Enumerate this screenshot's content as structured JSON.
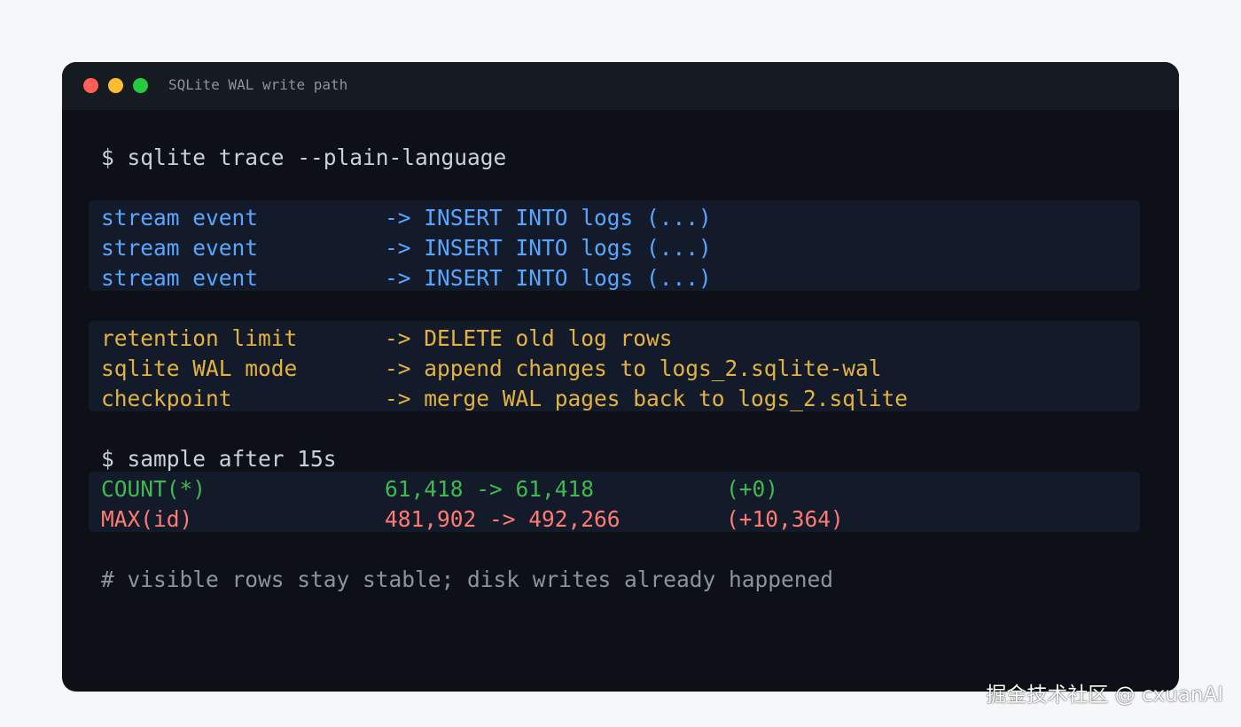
{
  "window": {
    "title": "SQLite WAL write path",
    "controls": [
      {
        "name": "close",
        "color": "#ff5f57"
      },
      {
        "name": "minimize",
        "color": "#febc2e"
      },
      {
        "name": "zoom",
        "color": "#28c840"
      }
    ]
  },
  "colors": {
    "background": "#f6f7f9",
    "terminal_bg": "#0d1117",
    "titlebar_bg": "#161b22",
    "block_bg": "#131a2a",
    "prompt": "#c9d1d9",
    "blue": "#58a6ff",
    "orange": "#e3b341",
    "green": "#3fb950",
    "red": "#ff7b72",
    "comment": "#8b949e"
  },
  "terminal": {
    "command_1": "$ sqlite trace --plain-language",
    "insert_rows": [
      {
        "label": "stream event",
        "action": "-> INSERT INTO logs (...)"
      },
      {
        "label": "stream event",
        "action": "-> INSERT INTO logs (...)"
      },
      {
        "label": "stream event",
        "action": "-> INSERT INTO logs (...)"
      }
    ],
    "wal_rows": [
      {
        "label": "retention limit",
        "action": "-> DELETE old log rows"
      },
      {
        "label": "sqlite WAL mode",
        "action": "-> append changes to logs_2.sqlite-wal"
      },
      {
        "label": "checkpoint",
        "action": "-> merge WAL pages back to logs_2.sqlite"
      }
    ],
    "command_2": "$ sample after 15s",
    "samples": [
      {
        "label": "COUNT(*)",
        "values": "61,418 -> 61,418",
        "delta": "(+0)"
      },
      {
        "label": "MAX(id)",
        "values": "481,902 -> 492,266",
        "delta": "(+10,364)"
      }
    ],
    "comment": "# visible rows stay stable; disk writes already happened"
  },
  "watermark": "掘金技术社区 @ cxuanAI"
}
